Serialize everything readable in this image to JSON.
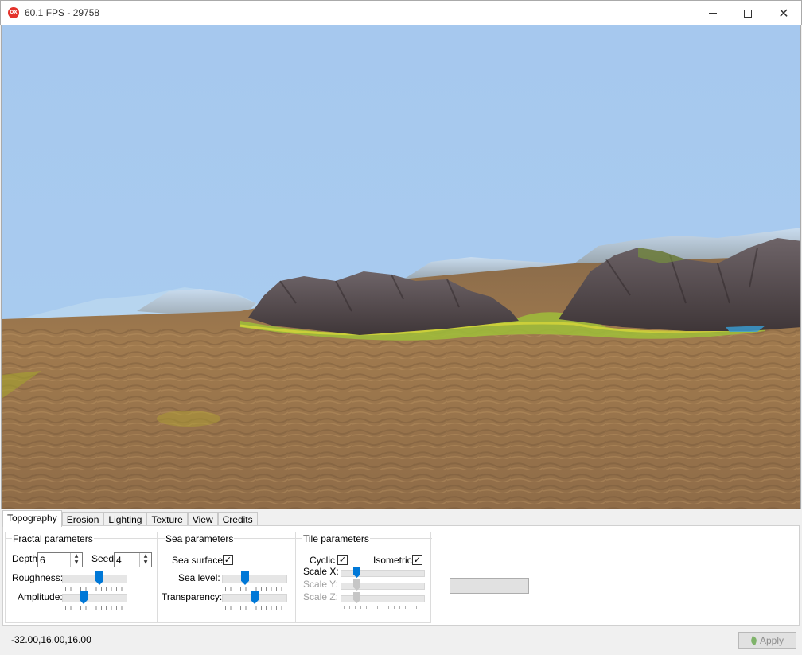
{
  "window": {
    "title": "60.1 FPS - 29758",
    "app_icon_text": "OX"
  },
  "tabs": [
    "Topography",
    "Erosion",
    "Lighting",
    "Texture",
    "View",
    "Credits"
  ],
  "fractal": {
    "title": "Fractal parameters",
    "depth_label": "Depth:",
    "depth_value": "6",
    "seed_label": "Seed:",
    "seed_value": "4",
    "roughness_label": "Roughness:",
    "roughness_level": 0.58,
    "amplitude_label": "Amplitude:",
    "amplitude_level": 0.3
  },
  "sea": {
    "title": "Sea parameters",
    "surface_label": "Sea surface",
    "surface_checked": true,
    "level_label": "Sea level:",
    "level_value": 0.33,
    "transparency_label": "Transparency:",
    "transparency_value": 0.5
  },
  "tile": {
    "title": "Tile parameters",
    "cyclic_label": "Cyclic",
    "cyclic_checked": true,
    "isometric_label": "Isometric",
    "isometric_checked": true,
    "scale_x_label": "Scale X:",
    "scale_x_value": 0.17,
    "scale_y_label": "Scale Y:",
    "scale_y_value": 0.17,
    "scale_z_label": "Scale Z:",
    "scale_z_value": 0.17
  },
  "status": {
    "coords": "-32.00,16.00,16.00",
    "apply_label": "Apply"
  },
  "colors": {
    "sky": "#a7caef",
    "ground": "#8b6a45",
    "rock": "#5c5054",
    "accent": "#0078d7"
  }
}
